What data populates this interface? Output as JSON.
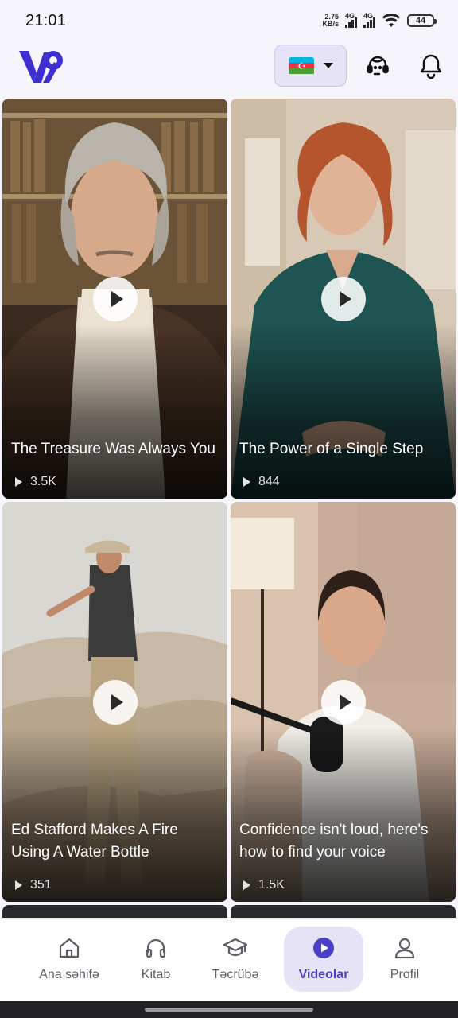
{
  "status_bar": {
    "time": "21:01",
    "net_speed_value": "2.75",
    "net_speed_unit": "KB/s",
    "network_1": "4G",
    "network_2": "4G",
    "battery": "44"
  },
  "header": {
    "logo_icon": "brand-logo-icon",
    "language_flag": "azerbaijan-flag-icon",
    "support_icon": "support-agent-icon",
    "notifications_icon": "bell-icon"
  },
  "videos": [
    {
      "title": "The Treasure Was Always You",
      "views": "3.5K"
    },
    {
      "title": "The Power of a Single Step",
      "views": "844"
    },
    {
      "title": "Ed Stafford Makes A Fire Using A Water Bottle",
      "views": "351"
    },
    {
      "title": "Confidence isn't loud, here's how to find your voice",
      "views": "1.5K"
    }
  ],
  "nav": {
    "items": [
      {
        "label": "Ana səhifə",
        "icon": "home-icon"
      },
      {
        "label": "Kitab",
        "icon": "headphones-icon"
      },
      {
        "label": "Təcrübə",
        "icon": "graduation-cap-icon"
      },
      {
        "label": "Videolar",
        "icon": "play-circle-icon"
      },
      {
        "label": "Profil",
        "icon": "person-icon"
      }
    ],
    "active": "Videolar"
  },
  "colors": {
    "accent": "#4b3fc7",
    "accent_soft": "#e6e3f6",
    "logo": "#3f2fd0",
    "background": "#f6f5fb"
  }
}
